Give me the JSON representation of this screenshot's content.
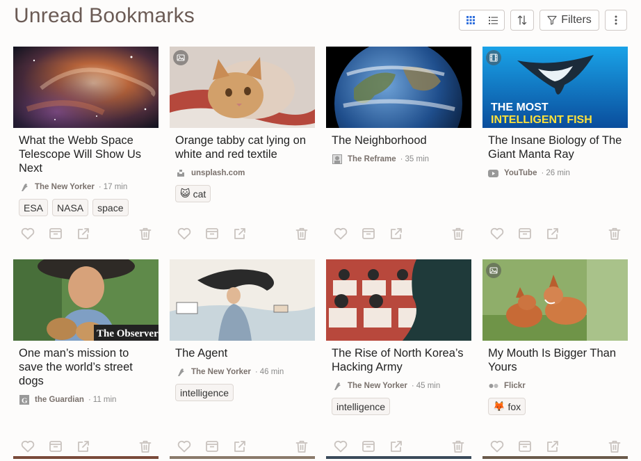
{
  "header": {
    "title": "Unread Bookmarks",
    "filters_label": "Filters"
  },
  "cards": [
    {
      "title": "What the Webb Space Telescope Will Show Us Next",
      "source": "The New Yorker",
      "time": "17 min",
      "tags": [
        "ESA",
        "NASA",
        "space"
      ]
    },
    {
      "title": "Orange tabby cat lying on white and red textile",
      "source": "unsplash.com",
      "time": "",
      "tag_emoji": "😺",
      "tags": [
        "cat"
      ]
    },
    {
      "title": "The Neighborhood",
      "source": "The Reframe",
      "time": "35 min",
      "tags": []
    },
    {
      "title": "The Insane Biology of The Giant Manta Ray",
      "source": "YouTube",
      "time": "26 min",
      "thumb_text": [
        "THE MOST",
        "INTELLIGENT FISH"
      ],
      "tags": []
    },
    {
      "title": "One man’s mission to save the world’s street dogs",
      "source": "the Guardian",
      "time": "11 min",
      "thumb_text": "The Observer",
      "tags": []
    },
    {
      "title": "The Agent",
      "source": "The New Yorker",
      "time": "46 min",
      "tags": [
        "intelligence"
      ]
    },
    {
      "title": "The Rise of North Korea’s Hacking Army",
      "source": "The New Yorker",
      "time": "45 min",
      "tags": [
        "intelligence"
      ]
    },
    {
      "title": "My Mouth Is Bigger Than Yours",
      "source": "Flickr",
      "time": "",
      "tag_emoji": "🦊",
      "tags": [
        "fox"
      ]
    }
  ],
  "sep": "·",
  "icons": {
    "grid_view": "grid-icon",
    "list_view": "list-icon",
    "sort": "sort-icon",
    "filter": "filter-icon",
    "more": "kebab-icon",
    "favorite": "heart-icon",
    "archive": "archive-icon",
    "open": "external-link-icon",
    "delete": "trash-icon"
  },
  "colors": {
    "title": "#6b5b55",
    "accent": "#2f6fdd",
    "icon": "#c9c3bf"
  }
}
